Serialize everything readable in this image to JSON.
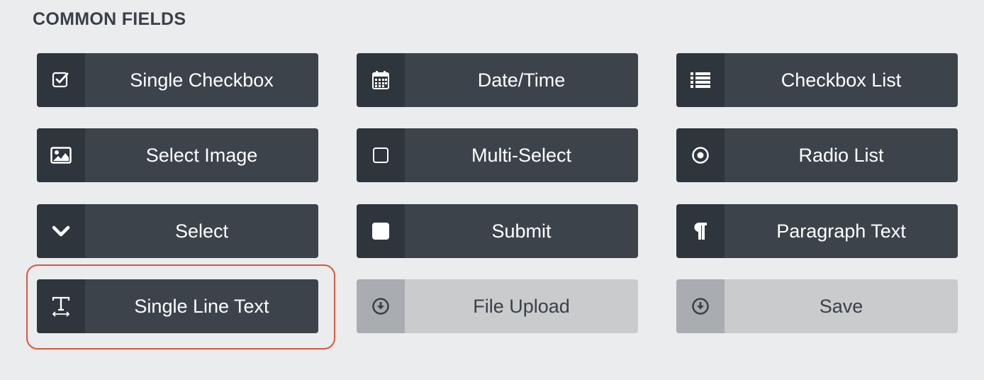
{
  "section": {
    "title": "COMMON FIELDS"
  },
  "fields": [
    {
      "label": "Single Checkbox",
      "icon": "checkbox-checked-icon"
    },
    {
      "label": "Date/Time",
      "icon": "calendar-icon"
    },
    {
      "label": "Checkbox List",
      "icon": "list-icon"
    },
    {
      "label": "Select Image",
      "icon": "image-icon"
    },
    {
      "label": "Multi-Select",
      "icon": "checkbox-empty-icon"
    },
    {
      "label": "Radio List",
      "icon": "radio-icon"
    },
    {
      "label": "Select",
      "icon": "chevron-down-icon"
    },
    {
      "label": "Submit",
      "icon": "square-icon"
    },
    {
      "label": "Paragraph Text",
      "icon": "pilcrow-icon"
    },
    {
      "label": "Single Line Text",
      "icon": "text-field-icon",
      "highlighted": true
    },
    {
      "label": "File Upload",
      "icon": "download-circle-icon",
      "disabled": true
    },
    {
      "label": "Save",
      "icon": "download-circle-icon",
      "disabled": true
    }
  ],
  "colors": {
    "background": "#ebecee",
    "button": "#3c434b",
    "icon_box": "#2f353c",
    "disabled_button": "#c9cbcd",
    "highlight": "#d9573f"
  }
}
